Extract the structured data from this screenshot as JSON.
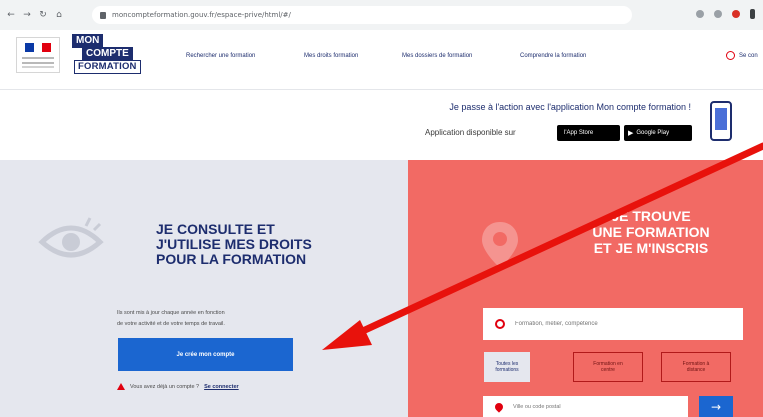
{
  "browser": {
    "back_icon": "back-arrow-icon",
    "forward_icon": "forward-arrow-icon",
    "reload_icon": "reload-icon",
    "home_icon": "home-icon",
    "url": "moncompteformation.gouv.fr/espace-prive/html/#/"
  },
  "header": {
    "nav": [
      "Rechercher une formation",
      "Mes droits formation",
      "Mes dossiers de formation",
      "Comprendre la formation"
    ],
    "user_label": "Se con",
    "logo_lines": [
      "MON",
      "COMPTE",
      "FORMATION"
    ],
    "flag_colors": [
      "#0a39a6",
      "#ffffff",
      "#e1000f"
    ]
  },
  "promo": {
    "line1": "Je passe à l'action avec l'application Mon compte formation !",
    "line2": "Application disponible sur",
    "app_store": "l'App Store",
    "google_play": "Google Play"
  },
  "left": {
    "title_lines": [
      "JE CONSULTE ET",
      "J'UTILISE MES DROITS",
      "POUR LA FORMATION"
    ],
    "desc_lines": [
      "Ils sont mis à jour chaque année en fonction",
      "de votre activité et de votre temps de travail."
    ],
    "cta": "Je crée mon compte",
    "login_question": "Vous avez déjà un compte ?",
    "login_link": "Se connecter"
  },
  "right": {
    "title_lines": [
      "JE TROUVE",
      "UNE FORMATION",
      "ET JE M'INSCRIS"
    ],
    "search_placeholder": "Formation, métier, compétence",
    "filters": [
      [
        "Toutes les",
        "formations"
      ],
      [
        "Formation en",
        "centre"
      ],
      [
        "Formation à",
        "distance"
      ]
    ],
    "location_placeholder": "Ville ou code postal",
    "go_label": "→"
  },
  "colors": {
    "navy": "#1d2d6e",
    "blue": "#1b66d0",
    "coral": "#f26a64",
    "grey_panel": "#e5e7ee",
    "red": "#e1000f"
  }
}
